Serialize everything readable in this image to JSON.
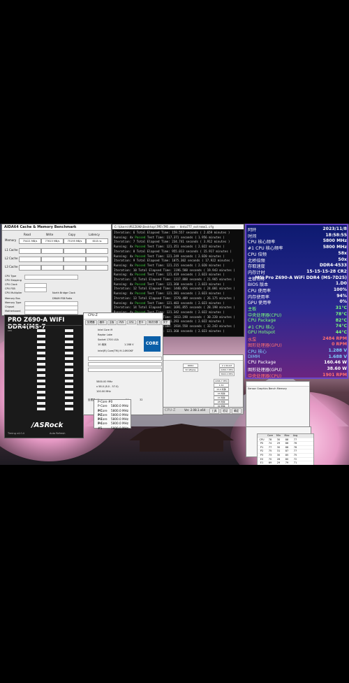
{
  "aida64": {
    "title": "AIDA64 Cache & Memory Benchmark",
    "columns": [
      "Read",
      "Write",
      "Copy",
      "Latency"
    ],
    "memory_label": "Memory",
    "memory_values": [
      "75421 MB/s",
      "77615 MB/s",
      "75195 MB/s",
      "60.8 ns"
    ],
    "cache_rows": [
      "L1 Cache",
      "L2 Cache",
      "L3 Cache"
    ],
    "info_labels": [
      "CPU Type",
      "CPU Stepping",
      "CPU Clock",
      "CPU FSB",
      "CPU Multiplier",
      "Memory Bus",
      "Memory Type",
      "Chipset",
      "Motherboard"
    ],
    "north_bridge_label": "North Bridge Clock",
    "dram_fsb_label": "DRAM:FSB Ratio",
    "start_button": "Start Benchmark",
    "close_button": "Close",
    "save_button": "Save",
    "footer": "AIDA64 v7.00.6700 / BenchDLL 4.6.881.8-x64 (c) 1995-2023 FinalWire Ltd."
  },
  "asrock": {
    "board_name": "PRO Z690-A WIFI DDR4(MS-7",
    "brand": "/ASRock",
    "footer_left": "Timing v4.0.4",
    "footer_right": "Auto Refresh"
  },
  "console": {
    "title": "C:\\Users\\MSIZ690\\Desktop\\TM5\\TM5.exe - Anta777_extreme1.cfg",
    "lines": [
      {
        "a": "Iteration: 6",
        "b": "Total Elapsed Time:",
        "c": "159.557 seconds  ( 2.659 minutes )"
      },
      {
        "a": "Running: 4x",
        "b": "Passed",
        "c": "Test Time:  117.371 seconds ( 1.956 minutes )"
      },
      {
        "a": "Iteration: 7",
        "b": "Total Elapsed Time:",
        "c": "234.741 seconds  ( 3.912 minutes )"
      },
      {
        "a": "Running: 4x",
        "b": "Passed",
        "c": "Test Time:  121.351 seconds ( 2.022 minutes )"
      },
      {
        "a": "Iteration: 8",
        "b": "Total Elapsed Time:",
        "c": "955.013 seconds  ( 15.917 minutes )"
      },
      {
        "a": "Running: 4x",
        "b": "Passed",
        "c": "Test Time:  121.249 seconds ( 2.020 minutes )"
      },
      {
        "a": "Iteration: 9",
        "b": "Total Elapsed Time:",
        "c": "1075.302 seconds ( 17.922 minutes )"
      },
      {
        "a": "Running: 4x",
        "b": "Passed",
        "c": "Test Time:  121.215 seconds ( 2.020 minutes )"
      },
      {
        "a": "Iteration: 10",
        "b": "Total Elapsed Time:",
        "c": "1196.588 seconds ( 19.943 minutes )"
      },
      {
        "a": "Running: 4x",
        "b": "Passed",
        "c": "Test Time:  121.419 seconds ( 2.023 minutes )"
      },
      {
        "a": "Iteration: 11",
        "b": "Total Elapsed Time:",
        "c": "1317.888 seconds ( 21.965 minutes )"
      },
      {
        "a": "Running: 4x",
        "b": "Passed",
        "c": "Test Time:  121.360 seconds ( 2.023 minutes )"
      },
      {
        "a": "Iteration: 12",
        "b": "Total Elapsed Time:",
        "c": "1440.056 seconds ( 24.001 minutes )"
      },
      {
        "a": "Running: 4x",
        "b": "Passed",
        "c": "Test Time:  121.381 seconds ( 2.023 minutes )"
      },
      {
        "a": "Iteration: 13",
        "b": "Total Elapsed Time:",
        "c": "1570.489 seconds ( 26.175 minutes )"
      },
      {
        "a": "Running: 4x",
        "b": "Passed",
        "c": "Test Time:  121.403 seconds ( 2.023 minutes )"
      },
      {
        "a": "Iteration: 14",
        "b": "Total Elapsed Time:",
        "c": "1691.855 seconds ( 28.198 minutes )"
      },
      {
        "a": "Running: 4x",
        "b": "Passed",
        "c": "Test Time:  121.342 seconds ( 2.022 minutes )"
      },
      {
        "a": "Iteration: 15",
        "b": "Total Elapsed Time:",
        "c": "1813.198 seconds ( 30.220 minutes )"
      },
      {
        "a": "Running: 4x",
        "b": "Passed",
        "c": "Test Time:  121.293 seconds ( 2.022 minutes )"
      },
      {
        "a": "Iteration: 16",
        "b": "Total Elapsed Time:",
        "c": "1934.558 seconds ( 32.243 minutes )"
      },
      {
        "a": "Running: 4x",
        "b": "Passed",
        "c": "Test Time:  121.360 seconds ( 2.023 minutes )"
      }
    ]
  },
  "cpuz": {
    "title": "CPU-Z",
    "tabs": [
      "处理器",
      "缓存",
      "主板",
      "内存",
      "SPD",
      "显卡",
      "测试分数",
      "关于"
    ],
    "name": "Intel Core i9",
    "codename": "Raptor Lake",
    "package": "Socket 1700 LGA",
    "tech": "10 纳米",
    "voltage": "1.288 V",
    "spec": "Intel(R) Core(TM) i9-14900KF",
    "core_speed": "5800.00 MHz",
    "multiplier": "x 58.0 (8.0 - 57.0)",
    "bus_speed": "100.00 MHz",
    "logo_text": "CORE i9",
    "selection": "处理器 #1",
    "cores": "24",
    "threads": "32"
  },
  "clock_menu": {
    "items": [
      "P-Core #0",
      "P-Core #1",
      "P-Core #2",
      "P-Core #3",
      "P-Core #4",
      "P-Core #5"
    ],
    "value": "5800.0 MHz"
  },
  "memory": {
    "type": "DDR4",
    "size": "32 GBytes",
    "channels": "2 x 64-bit",
    "mem_controller": "2266.7 MHz",
    "uncore": "3600.0 MHz",
    "dram_freq": "2266.7 MHz",
    "fsb_dram": "1:34",
    "cas": "15.0 时钟",
    "trcd": "15 时钟",
    "trp": "15 时钟",
    "tras": "28 时钟",
    "trc": "35 时钟",
    "cr": "2T"
  },
  "taskbar": {
    "brand": "CPU-Z",
    "version": "Ver. 2.08.1.x64",
    "tools": "工具",
    "validate": "验证",
    "ok": "确定"
  },
  "sensor_panel": {
    "rows": [
      {
        "label": "阿旰",
        "value": "2023/11/8",
        "color": "#ffffff",
        "valcolor": "#ffffff"
      },
      {
        "label": "时间",
        "value": "18:58:55",
        "color": "#ffffff",
        "valcolor": "#ffffff"
      },
      {
        "label": "CPU 核心频率",
        "value": "5800 MHz",
        "color": "#ffffff",
        "valcolor": "#ffffff"
      },
      {
        "label": "#1 CPU 核心频率",
        "value": "5800 MHz",
        "color": "#ffffff",
        "valcolor": "#ffffff"
      },
      {
        "label": "CPU 倍频",
        "value": "58x",
        "color": "#ffffff",
        "valcolor": "#ffffff"
      },
      {
        "label": "北桥倍频",
        "value": "50x",
        "color": "#ffffff",
        "valcolor": "#ffffff"
      },
      {
        "label": "存取速度",
        "value": "DDR4-4533",
        "color": "#ffffff",
        "valcolor": "#ffffff"
      },
      {
        "label": "内存计时",
        "value": "15-15-15-28 CR2",
        "color": "#ffffff",
        "valcolor": "#ffffff"
      },
      {
        "label": "主板名称",
        "value": "MSI Pro Z690-A WiFi DDR4 (MS-7D25)",
        "color": "#ffffff",
        "valcolor": "#ffffff"
      },
      {
        "label": "BIOS 版本",
        "value": "1.D0",
        "color": "#ffffff",
        "valcolor": "#ffffff"
      },
      {
        "label": "CPU 使用率",
        "value": "100%",
        "color": "#ffffff",
        "valcolor": "#ffffff"
      },
      {
        "label": "内存使用率",
        "value": "94%",
        "color": "#ffffff",
        "valcolor": "#ffffff"
      },
      {
        "label": "GPU 使用率",
        "value": "0%",
        "color": "#ffffff",
        "valcolor": "#ffffff"
      },
      {
        "label": "主板",
        "value": "31°C",
        "color": "#7cff7c",
        "valcolor": "#7cff7c"
      },
      {
        "label": "中央处理器(CPU)",
        "value": "78°C",
        "color": "#7cff7c",
        "valcolor": "#7cff7c"
      },
      {
        "label": "CPU Package",
        "value": "82°C",
        "color": "#7cff7c",
        "valcolor": "#7cff7c"
      },
      {
        "label": "#1 CPU 核心",
        "value": "74°C",
        "color": "#7cff7c",
        "valcolor": "#7cff7c"
      },
      {
        "label": "GPU Hotspot",
        "value": "44°C",
        "color": "#7cff7c",
        "valcolor": "#7cff7c"
      },
      {
        "label": "水泵",
        "value": "2484 RPM",
        "color": "#ff7070",
        "valcolor": "#ff7070"
      },
      {
        "label": "图形处理器(GPU)",
        "value": "0 RPM",
        "color": "#ff7070",
        "valcolor": "#ff7070"
      },
      {
        "label": "CPU 核心",
        "value": "1.288 V",
        "color": "#7fd0ff",
        "valcolor": "#7fd0ff"
      },
      {
        "label": "DIMM",
        "value": "1.688 V",
        "color": "#7fd0ff",
        "valcolor": "#7fd0ff"
      },
      {
        "label": "CPU Package",
        "value": "160.46 W",
        "color": "#ffffff",
        "valcolor": "#ffffff"
      },
      {
        "label": "图形处理器(GPU)",
        "value": "38.60 W",
        "color": "#ffffff",
        "valcolor": "#ffffff"
      },
      {
        "label": "中央处理器(CPU)",
        "value": "1901 RPM",
        "color": "#ff7070",
        "valcolor": "#ff7070"
      }
    ]
  },
  "hwinfo_small": {
    "tab_labels": [
      "Sensor",
      "Graphics",
      "Bench",
      "Memory"
    ],
    "table_header": [
      "",
      "Core",
      "Min",
      "Max",
      "Avg"
    ],
    "table_rows": [
      [
        "CPU",
        "78",
        "30",
        "88",
        "77"
      ],
      [
        "P0",
        "74",
        "29",
        "86",
        "76"
      ],
      [
        "P1",
        "77",
        "30",
        "88",
        "78"
      ],
      [
        "P2",
        "75",
        "31",
        "87",
        "77"
      ],
      [
        "P3",
        "73",
        "30",
        "85",
        "75"
      ],
      [
        "E0",
        "70",
        "28",
        "80",
        "72"
      ],
      [
        "E1",
        "69",
        "29",
        "79",
        "71"
      ]
    ]
  }
}
